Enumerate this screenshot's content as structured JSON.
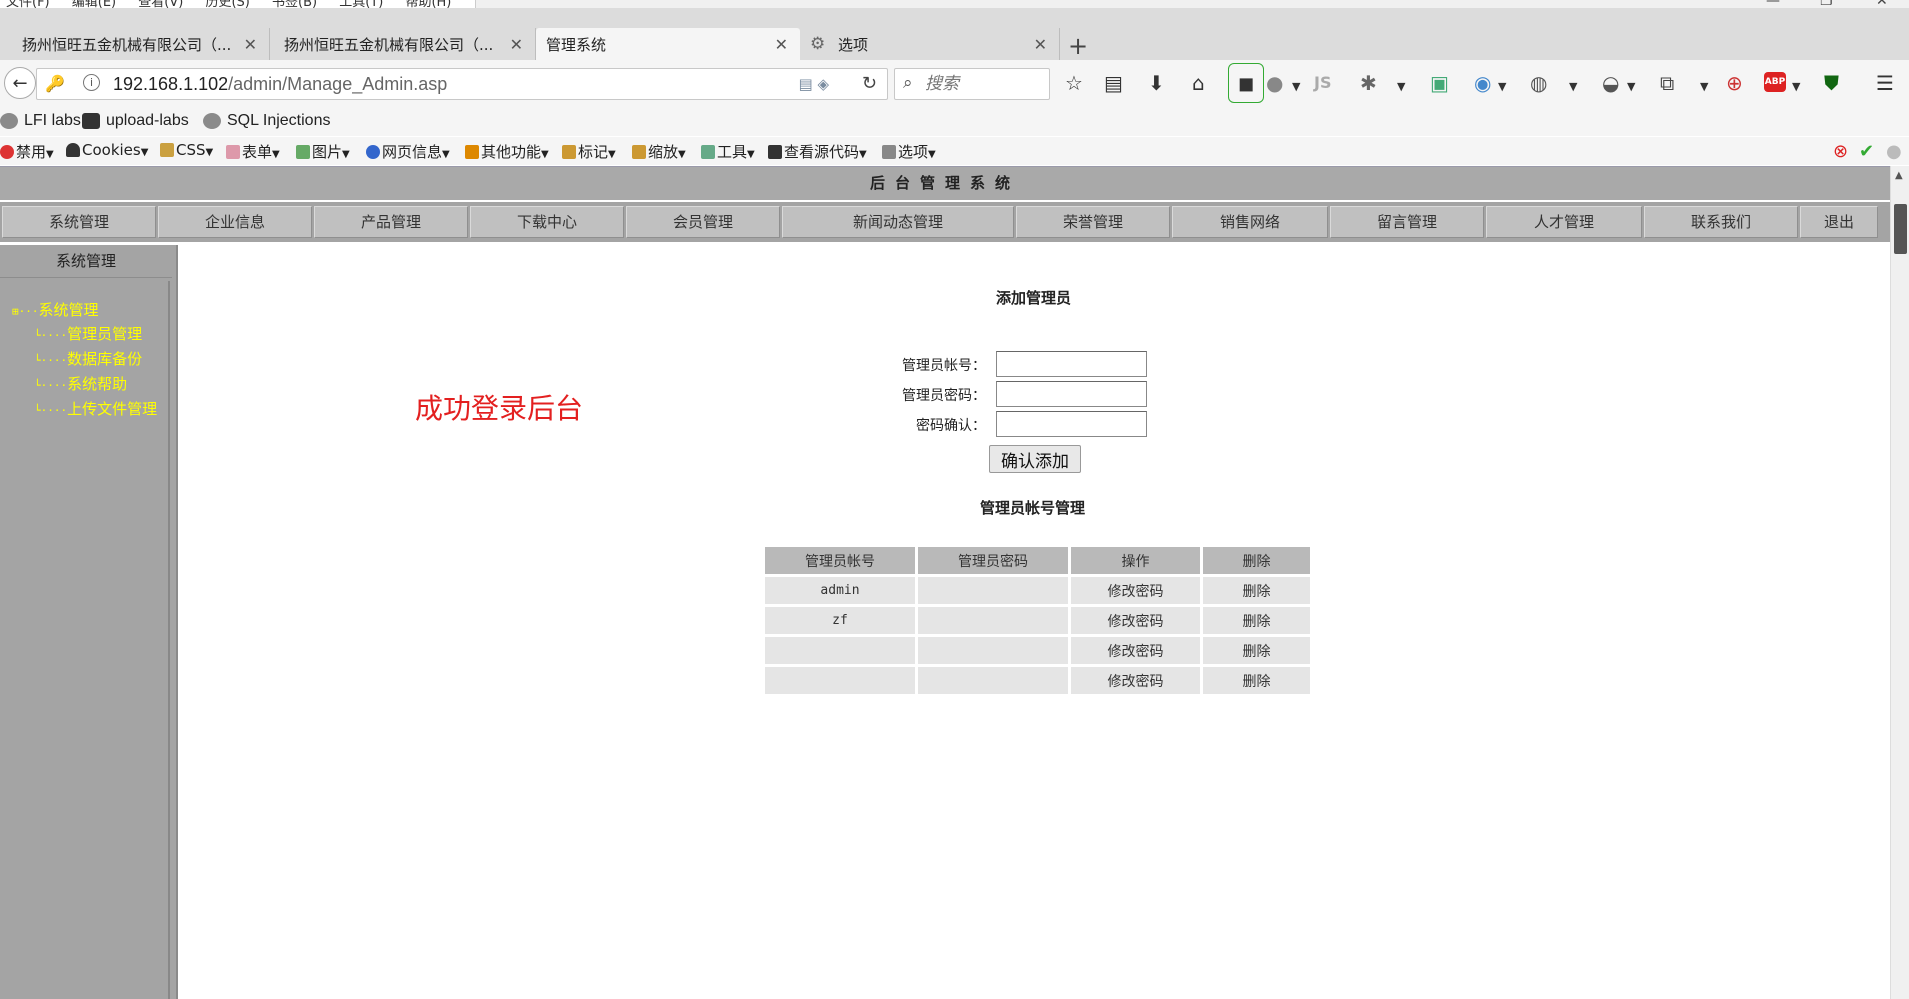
{
  "browser": {
    "menu": [
      "文件(F)",
      "编辑(E)",
      "查看(V)",
      "历史(S)",
      "书签(B)",
      "工具(T)",
      "帮助(H)"
    ],
    "tabs": [
      {
        "label": "扬州恒旺五金机械有限公司（..."
      },
      {
        "label": "扬州恒旺五金机械有限公司（..."
      },
      {
        "label": "管理系统"
      },
      {
        "label": "选项"
      }
    ],
    "url_host": "192.168.1.102",
    "url_path": "/admin/Manage_Admin.asp",
    "search_placeholder": "搜索",
    "bookmarks": [
      "LFI labs",
      "upload-labs",
      "SQL Injections"
    ],
    "devbar": [
      "禁用",
      "Cookies",
      "CSS",
      "表单",
      "图片",
      "网页信息",
      "其他功能",
      "标记",
      "缩放",
      "工具",
      "查看源代码",
      "选项"
    ]
  },
  "page": {
    "system_title": "后台管理系统",
    "nav": [
      "系统管理",
      "企业信息",
      "产品管理",
      "下载中心",
      "会员管理",
      "新闻动态管理",
      "荣誉管理",
      "销售网络",
      "留言管理",
      "人才管理",
      "联系我们",
      "退出"
    ],
    "sidebar": {
      "title": "系统管理",
      "root": "系统管理",
      "items": [
        "管理员管理",
        "数据库备份",
        "系统帮助",
        "上传文件管理"
      ]
    },
    "annotation": "成功登录后台",
    "add_form": {
      "title": "添加管理员",
      "account_label": "管理员帐号：",
      "password_label": "管理员密码：",
      "confirm_label": "密码确认：",
      "submit": "确认添加"
    },
    "admin_table": {
      "title": "管理员帐号管理",
      "headers": [
        "管理员帐号",
        "管理员密码",
        "操作",
        "删除"
      ],
      "rows": [
        {
          "account": "admin",
          "password": "",
          "op": "修改密码",
          "del": "删除"
        },
        {
          "account": "zf",
          "password": "",
          "op": "修改密码",
          "del": "删除"
        },
        {
          "account": "",
          "password": "",
          "op": "修改密码",
          "del": "删除"
        },
        {
          "account": "",
          "password": "",
          "op": "修改密码",
          "del": "删除"
        }
      ]
    }
  },
  "colors": {
    "sidebar_link": "#ffff00",
    "annotation": "#e32020",
    "chrome_gray": "#a4a4a4"
  }
}
